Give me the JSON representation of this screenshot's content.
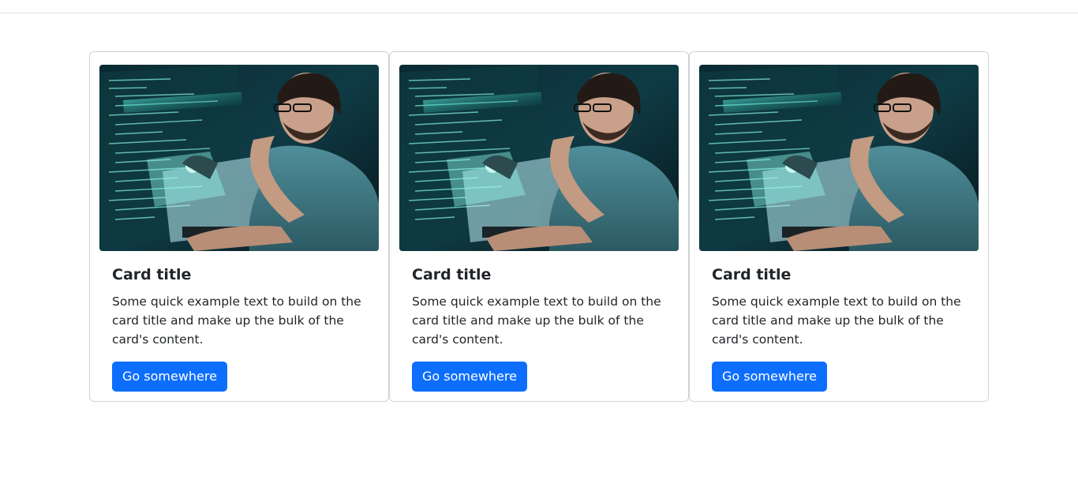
{
  "cards": [
    {
      "title": "Card title",
      "text": "Some quick example text to build on the card title and make up the bulk of the card's content.",
      "button_label": "Go somewhere",
      "image": "developer-coding-photo"
    },
    {
      "title": "Card title",
      "text": "Some quick example text to build on the card title and make up the bulk of the card's content.",
      "button_label": "Go somewhere",
      "image": "developer-coding-photo"
    },
    {
      "title": "Card title",
      "text": "Some quick example text to build on the card title and make up the bulk of the card's content.",
      "button_label": "Go somewhere",
      "image": "developer-coding-photo"
    }
  ],
  "colors": {
    "primary": "#0d6efd",
    "text": "#212529",
    "border": "#d0d3d6"
  }
}
